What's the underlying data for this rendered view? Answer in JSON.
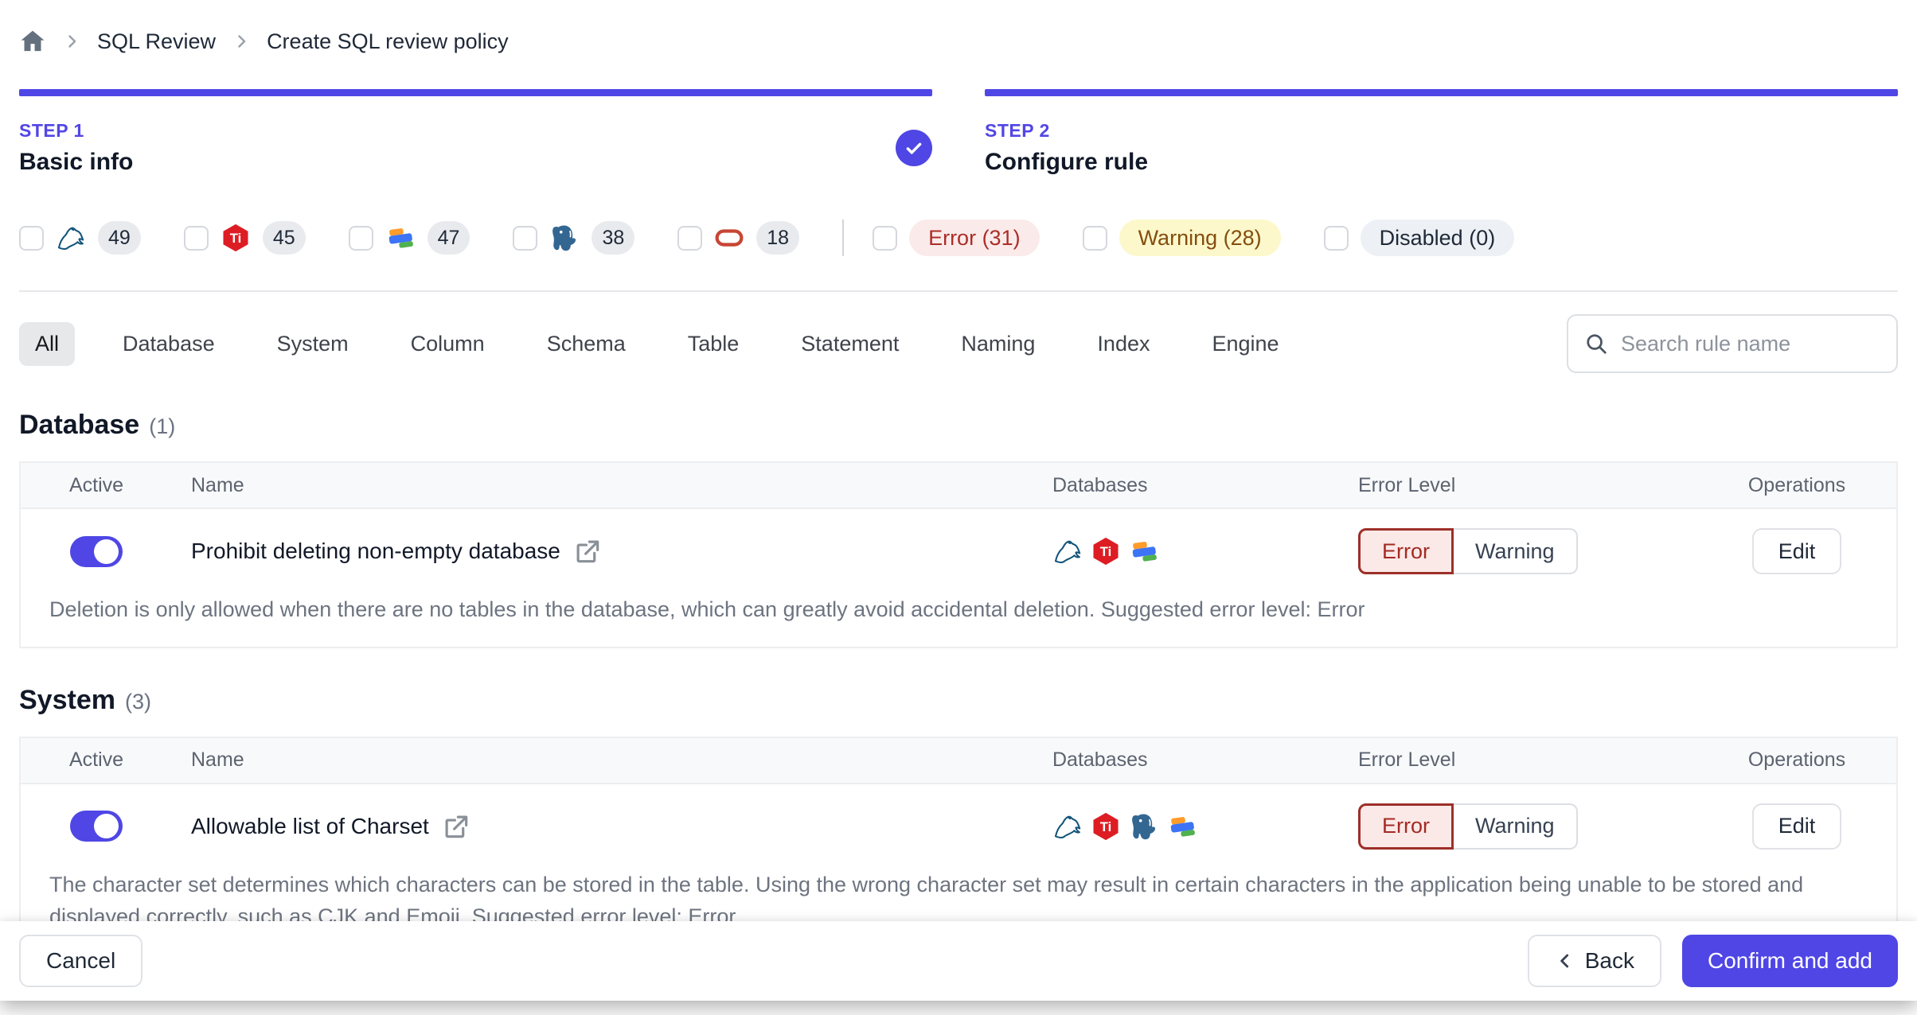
{
  "breadcrumb": {
    "items": [
      "SQL Review",
      "Create SQL review policy"
    ]
  },
  "steps": [
    {
      "label": "STEP 1",
      "title": "Basic info",
      "completed": true
    },
    {
      "label": "STEP 2",
      "title": "Configure rule",
      "completed": false
    }
  ],
  "filters": {
    "engines": [
      {
        "name": "MySQL",
        "count": "49"
      },
      {
        "name": "TiDB",
        "count": "45"
      },
      {
        "name": "OceanBase",
        "count": "47"
      },
      {
        "name": "PostgreSQL",
        "count": "38"
      },
      {
        "name": "Oracle",
        "count": "18"
      }
    ],
    "levels": [
      {
        "label": "Error (31)",
        "type": "error"
      },
      {
        "label": "Warning (28)",
        "type": "warning"
      },
      {
        "label": "Disabled (0)",
        "type": "disabled"
      }
    ]
  },
  "tabs": [
    {
      "label": "All",
      "active": true
    },
    {
      "label": "Database",
      "active": false
    },
    {
      "label": "System",
      "active": false
    },
    {
      "label": "Column",
      "active": false
    },
    {
      "label": "Schema",
      "active": false
    },
    {
      "label": "Table",
      "active": false
    },
    {
      "label": "Statement",
      "active": false
    },
    {
      "label": "Naming",
      "active": false
    },
    {
      "label": "Index",
      "active": false
    },
    {
      "label": "Engine",
      "active": false
    }
  ],
  "search": {
    "placeholder": "Search rule name"
  },
  "sections": [
    {
      "title": "Database",
      "count": "(1)",
      "columns": [
        "Active",
        "Name",
        "Databases",
        "Error Level",
        "Operations"
      ],
      "rows": [
        {
          "active": true,
          "name": "Prohibit deleting non-empty database",
          "databases": [
            "MySQL",
            "TiDB",
            "OceanBase"
          ],
          "level_options": [
            "Error",
            "Warning"
          ],
          "selected_level": "Error",
          "operation": "Edit",
          "description": "Deletion is only allowed when there are no tables in the database, which can greatly avoid accidental deletion. Suggested error level: Error"
        }
      ]
    },
    {
      "title": "System",
      "count": "(3)",
      "columns": [
        "Active",
        "Name",
        "Databases",
        "Error Level",
        "Operations"
      ],
      "rows": [
        {
          "active": true,
          "name": "Allowable list of Charset",
          "databases": [
            "MySQL",
            "TiDB",
            "PostgreSQL",
            "OceanBase"
          ],
          "level_options": [
            "Error",
            "Warning"
          ],
          "selected_level": "Error",
          "operation": "Edit",
          "description": "The character set determines which characters can be stored in the table. Using the wrong character set may result in certain characters in the application being unable to be stored and displayed correctly, such as CJK and Emoji. Suggested error level: Error"
        }
      ]
    }
  ],
  "footer": {
    "cancel_label": "Cancel",
    "back_label": "Back",
    "confirm_label": "Confirm and add"
  },
  "colors": {
    "accent": "#4f46e5",
    "error_text": "#a32b22",
    "error_bg": "#fbe9e8",
    "warning_text": "#854d0e",
    "warning_bg": "#fcf8cb",
    "disabled_bg": "#edf0f4"
  }
}
